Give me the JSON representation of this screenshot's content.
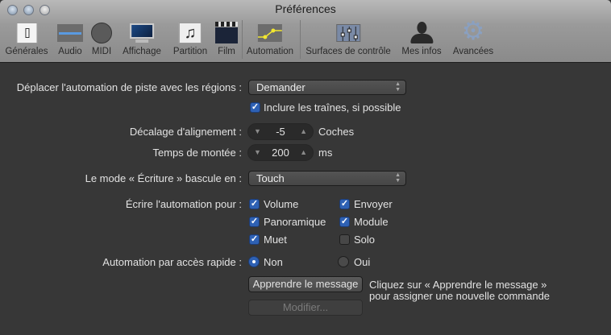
{
  "window": {
    "title": "Préférences"
  },
  "toolbar": {
    "items": [
      {
        "label": "Générales",
        "icon": "general-switch-icon",
        "selected": true
      },
      {
        "label": "Audio",
        "icon": "audio-waveform-icon"
      },
      {
        "label": "MIDI",
        "icon": "midi-connector-icon"
      },
      {
        "label": "Affichage",
        "icon": "display-monitor-icon"
      },
      {
        "label": "Partition",
        "icon": "score-notes-icon"
      },
      {
        "label": "Film",
        "icon": "movie-clapper-icon"
      },
      {
        "label": "Automation",
        "icon": "automation-curve-icon"
      },
      {
        "label": "Surfaces de contrôle",
        "icon": "control-surface-faders-icon"
      },
      {
        "label": "Mes infos",
        "icon": "user-silhouette-icon"
      },
      {
        "label": "Avancées",
        "icon": "gear-icon"
      }
    ]
  },
  "form": {
    "move_automation": {
      "label": "Déplacer l'automation de piste avec les régions :",
      "value": "Demander"
    },
    "include_tails": {
      "label": "Inclure les traînes, si possible",
      "checked": true
    },
    "alignment_offset": {
      "label": "Décalage d'alignement :",
      "value": "-5",
      "unit": "Coches"
    },
    "ramp_time": {
      "label": "Temps de montée :",
      "value": "200",
      "unit": "ms"
    },
    "write_mode": {
      "label": "Le mode « Écriture » bascule en :",
      "value": "Touch"
    },
    "write_automation": {
      "label": "Écrire l'automation pour :",
      "options": [
        {
          "label": "Volume",
          "checked": true
        },
        {
          "label": "Envoyer",
          "checked": true
        },
        {
          "label": "Panoramique",
          "checked": true
        },
        {
          "label": "Module",
          "checked": true
        },
        {
          "label": "Muet",
          "checked": true
        },
        {
          "label": "Solo",
          "checked": false
        }
      ]
    },
    "quick_access": {
      "label": "Automation par accès rapide :",
      "options": [
        {
          "label": "Non",
          "selected": true
        },
        {
          "label": "Oui",
          "selected": false
        }
      ]
    },
    "learn_button": "Apprendre le message",
    "edit_button": "Modifier...",
    "help_line1": "Cliquez sur « Apprendre le message »",
    "help_line2": "pour assigner une nouvelle commande"
  }
}
